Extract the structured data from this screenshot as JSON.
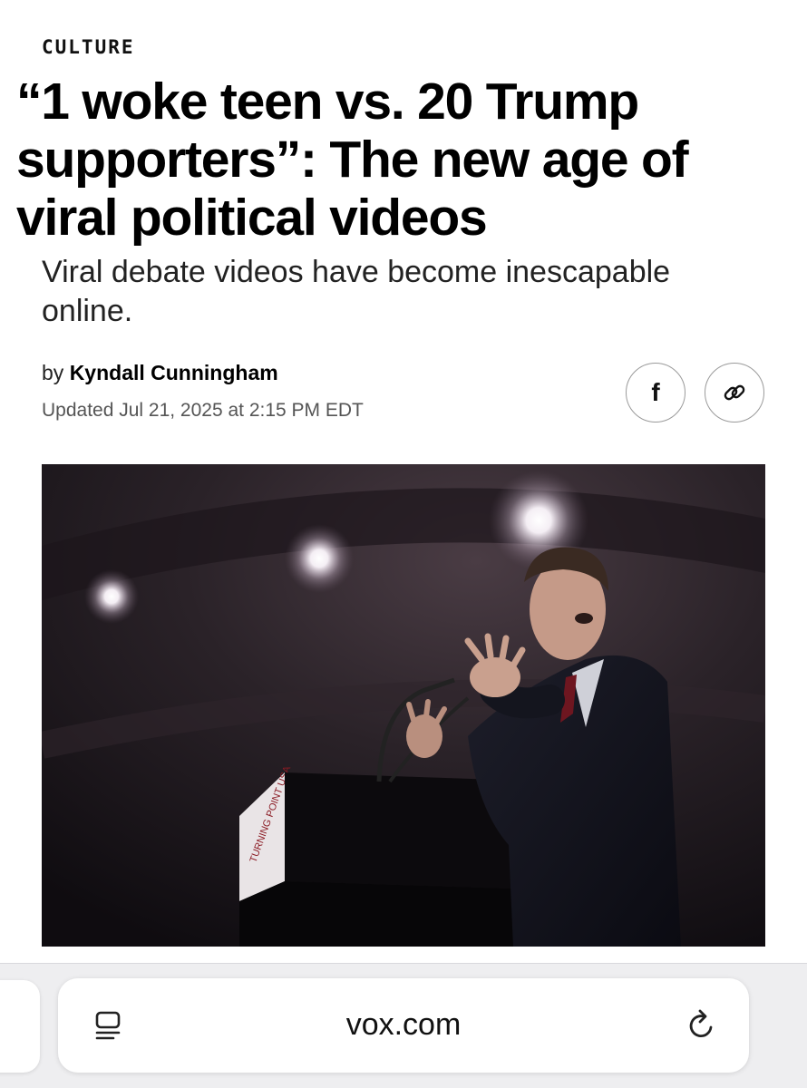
{
  "article": {
    "section": "CULTURE",
    "headline": "“1 woke teen vs. 20 Trump supporters”: The new age of viral political videos",
    "dek": "Viral debate videos have become inescapable online.",
    "byline_prefix": "by",
    "author": "Kyndall Cunningham",
    "updated": "Updated Jul 21, 2025 at 2:15 PM EDT"
  },
  "share": {
    "facebook_glyph": "f",
    "facebook_icon": "facebook-icon",
    "link_icon": "link-icon"
  },
  "photo": {
    "podium_sign": "TURNING POINT USA"
  },
  "browser": {
    "url": "vox.com",
    "reader_icon": "reader-mode-icon",
    "reload_icon": "reload-icon"
  }
}
